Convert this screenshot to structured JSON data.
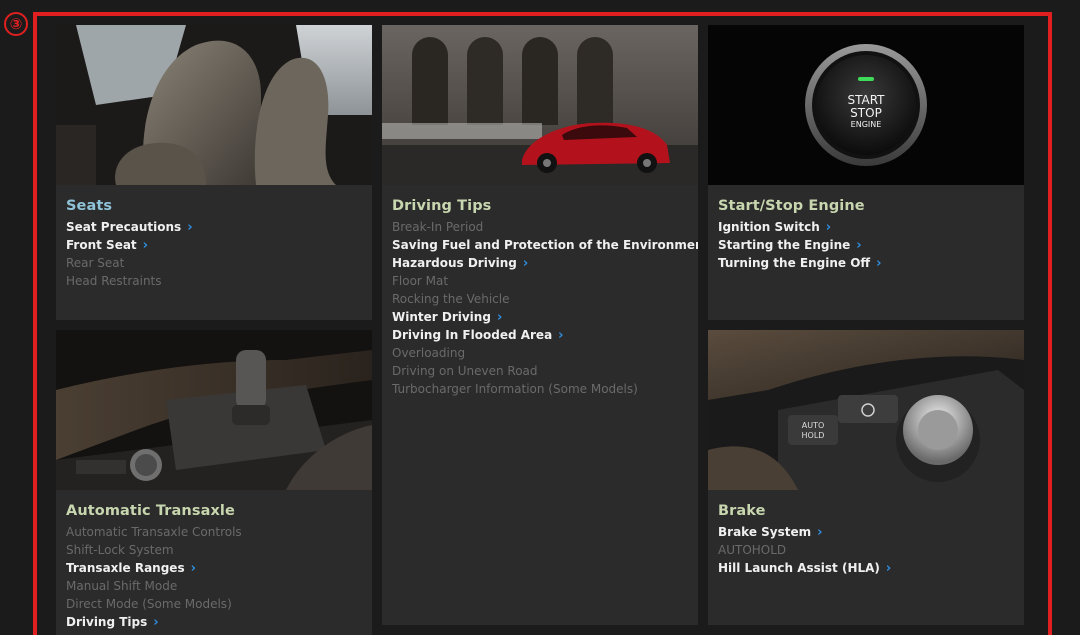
{
  "marker": "③",
  "cards": {
    "seats": {
      "title": "Seats",
      "items": [
        {
          "label": "Seat Precautions",
          "active": true
        },
        {
          "label": "Front Seat",
          "active": true
        },
        {
          "label": "Rear Seat",
          "active": false
        },
        {
          "label": "Head Restraints",
          "active": false
        }
      ]
    },
    "driving": {
      "title": "Driving Tips",
      "items": [
        {
          "label": "Break-In Period",
          "active": false
        },
        {
          "label": "Saving Fuel and Protection of the Environment",
          "active": true
        },
        {
          "label": "Hazardous Driving",
          "active": true
        },
        {
          "label": "Floor Mat",
          "active": false
        },
        {
          "label": "Rocking the Vehicle",
          "active": false
        },
        {
          "label": "Winter Driving",
          "active": true
        },
        {
          "label": "Driving In Flooded Area",
          "active": true
        },
        {
          "label": "Overloading",
          "active": false
        },
        {
          "label": "Driving on Uneven Road",
          "active": false
        },
        {
          "label": "Turbocharger Information (Some Models)",
          "active": false
        }
      ]
    },
    "start": {
      "title": "Start/Stop Engine",
      "button_text": [
        "START",
        "STOP",
        "ENGINE"
      ],
      "items": [
        {
          "label": "Ignition Switch",
          "active": true
        },
        {
          "label": "Starting the Engine",
          "active": true
        },
        {
          "label": "Turning the Engine Off",
          "active": true
        }
      ]
    },
    "trans": {
      "title": "Automatic Transaxle",
      "items": [
        {
          "label": "Automatic Transaxle Controls",
          "active": false
        },
        {
          "label": "Shift-Lock System",
          "active": false
        },
        {
          "label": "Transaxle Ranges",
          "active": true
        },
        {
          "label": "Manual Shift Mode",
          "active": false
        },
        {
          "label": "Direct Mode (Some Models)",
          "active": false
        },
        {
          "label": "Driving Tips",
          "active": true
        }
      ]
    },
    "brake": {
      "title": "Brake",
      "button_text": [
        "AUTO",
        "HOLD"
      ],
      "items": [
        {
          "label": "Brake System",
          "active": true
        },
        {
          "label": "AUTOHOLD",
          "active": false
        },
        {
          "label": "Hill Launch Assist (HLA)",
          "active": true
        }
      ]
    }
  },
  "colors": {
    "frame": "#e02020",
    "card_bg": "#2b2b2b",
    "link_chevron": "#2f8fe0",
    "title_blue": "#8fc3d8",
    "title_green": "#c7d6ae"
  }
}
